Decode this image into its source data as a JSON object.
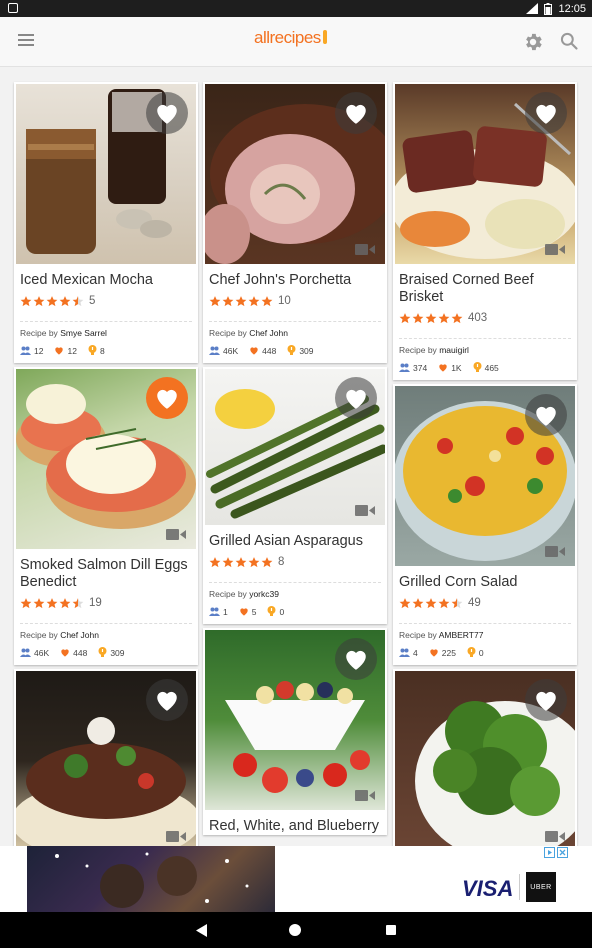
{
  "status_bar": {
    "time": "12:05"
  },
  "app_bar": {
    "logo": "allrecipes"
  },
  "recipes": [
    {
      "title": "Iced Mexican Mocha",
      "rating": 4.5,
      "reviews": "5",
      "author_prefix": "Recipe by",
      "author": "Smye Sarrel",
      "made_it": "12",
      "favorites": "12",
      "tips": "8",
      "favorited": false,
      "has_video": false
    },
    {
      "title": "Smoked Salmon Dill Eggs Benedict",
      "rating": 4.5,
      "reviews": "19",
      "author_prefix": "Recipe by",
      "author": "Chef John",
      "made_it": "46K",
      "favorites": "448",
      "tips": "309",
      "favorited": true,
      "has_video": true
    },
    {
      "title": "",
      "favorited": false,
      "has_video": true
    },
    {
      "title": "Chef John's Porchetta",
      "rating": 5,
      "reviews": "10",
      "author_prefix": "Recipe by",
      "author": "Chef John",
      "made_it": "46K",
      "favorites": "448",
      "tips": "309",
      "favorited": false,
      "has_video": true
    },
    {
      "title": "Grilled Asian Asparagus",
      "rating": 5,
      "reviews": "8",
      "author_prefix": "Recipe by",
      "author": "yorkc39",
      "made_it": "1",
      "favorites": "5",
      "tips": "0",
      "favorited": false,
      "has_video": true
    },
    {
      "title": "Red, White, and Blueberry",
      "favorited": false,
      "has_video": true
    },
    {
      "title": "Braised Corned Beef Brisket",
      "rating": 5,
      "reviews": "403",
      "author_prefix": "Recipe by",
      "author": "mauigirl",
      "made_it": "374",
      "favorites": "1K",
      "tips": "465",
      "favorited": false,
      "has_video": true
    },
    {
      "title": "Grilled Corn Salad",
      "rating": 4.5,
      "reviews": "49",
      "author_prefix": "Recipe by",
      "author": "AMBERT77",
      "made_it": "4",
      "favorites": "225",
      "tips": "0",
      "favorited": false,
      "has_video": true
    },
    {
      "title": "",
      "favorited": false,
      "has_video": true
    }
  ],
  "ad": {
    "brand1": "VISA",
    "brand2": "UBER"
  },
  "colors": {
    "accent": "#f37221",
    "star": "#f37221",
    "tip": "#f9a825",
    "made": "#5b7fc7"
  }
}
